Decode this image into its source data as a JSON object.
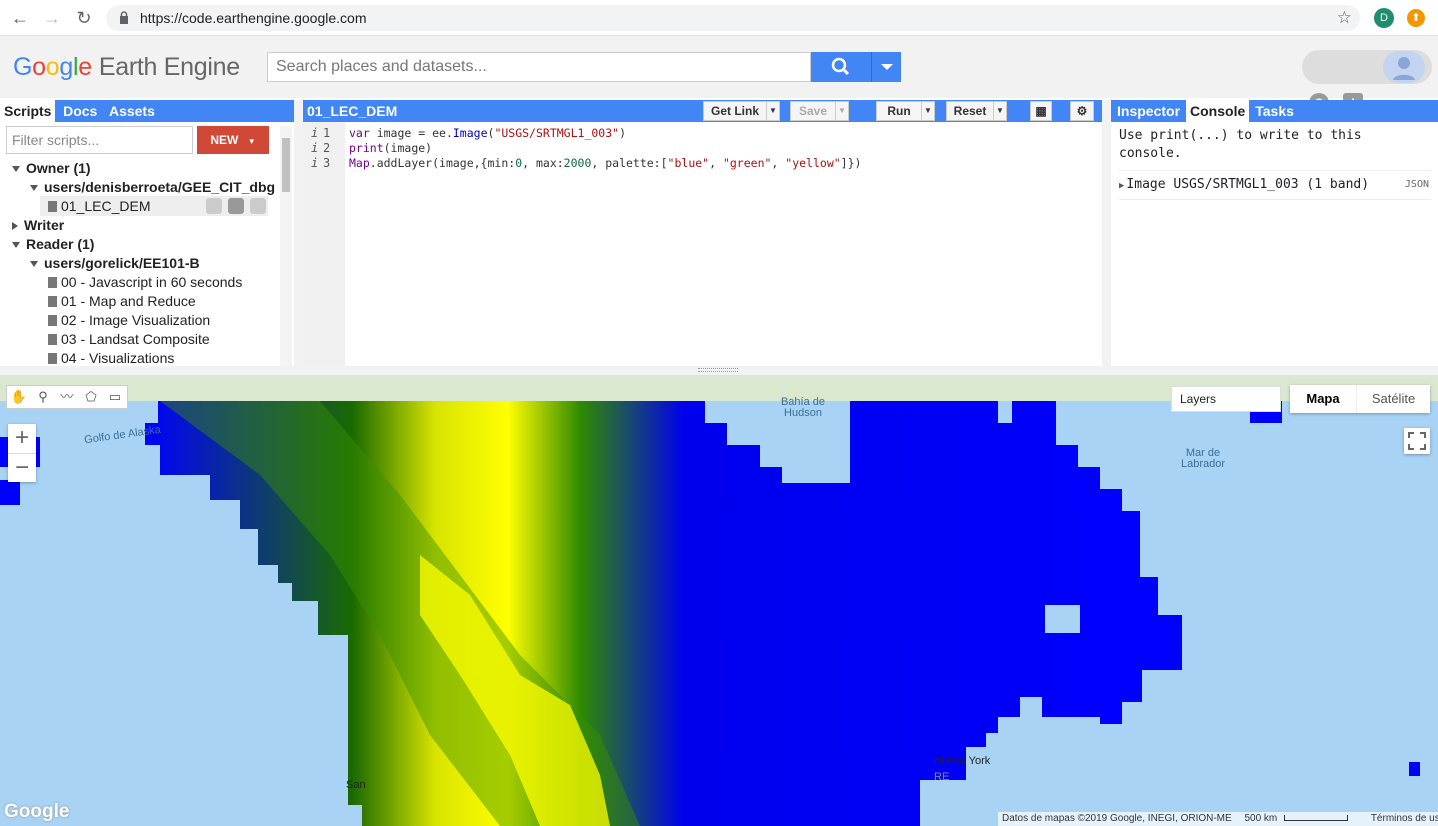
{
  "browser": {
    "url": "https://code.earthengine.google.com",
    "profile_initial": "D",
    "update_glyph": "⬆"
  },
  "header": {
    "logo_earth_engine": "Earth Engine",
    "search_placeholder": "Search places and datasets...",
    "help_glyph": "?",
    "feedback_glyph": "!"
  },
  "scripts_panel": {
    "tabs": [
      "Scripts",
      "Docs",
      "Assets"
    ],
    "active_tab": "Scripts",
    "filter_placeholder": "Filter scripts...",
    "new_button": "NEW",
    "tree": [
      {
        "label": "Owner  (1)"
      },
      {
        "label": "users/denisberroeta/GEE_CIT_dbg"
      },
      {
        "label": "01_LEC_DEM"
      },
      {
        "label": "Writer"
      },
      {
        "label": "Reader  (1)"
      },
      {
        "label": "users/gorelick/EE101-B"
      },
      {
        "label": "00 - Javascript in 60 seconds"
      },
      {
        "label": "01 - Map and Reduce"
      },
      {
        "label": "02 - Image Visualization"
      },
      {
        "label": "03 - Landsat Composite"
      },
      {
        "label": "04 - Visualizations"
      }
    ]
  },
  "editor": {
    "title": "01_LEC_DEM",
    "get_link": "Get Link",
    "save": "Save",
    "run": "Run",
    "reset": "Reset",
    "line_numbers": [
      "1",
      "2",
      "3"
    ],
    "code": {
      "l1_var": "var",
      "l1_name": " image = ee.",
      "l1_fn": "Image",
      "l1_open": "(",
      "l1_str": "\"USGS/SRTMGL1_003\"",
      "l1_close": ")",
      "l2_fn": "print",
      "l2_rest": "(image)",
      "l3_fn": "Map",
      "l3_a": ".addLayer(image,{min:",
      "l3_min": "0",
      "l3_b": ", max:",
      "l3_max": "2000",
      "l3_c": ", palette:[",
      "l3_s1": "\"blue\"",
      "l3_comma1": ", ",
      "l3_s2": "\"green\"",
      "l3_comma2": ", ",
      "l3_s3": "\"yellow\"",
      "l3_end": "]})"
    }
  },
  "right_panel": {
    "tabs": [
      "Inspector",
      "Console",
      "Tasks"
    ],
    "active_tab": "Console",
    "console_hint": "Use print(...) to write to this console.",
    "console_item": "Image USGS/SRTMGL1_003 (1 band)",
    "console_item_json": "JSON"
  },
  "map": {
    "layers_label": "Layers",
    "map_type_options": [
      "Mapa",
      "Satélite"
    ],
    "selected_map_type": "Mapa",
    "zoom_in": "+",
    "zoom_out": "−",
    "labels": {
      "hudson": "Bahía de Hudson",
      "alaska": "Golfo de Alaska",
      "labrador": "Mar de Labrador",
      "newyork": "Nueva York",
      "san": "San",
      "re": "RE"
    },
    "attribution": "Datos de mapas ©2019 Google, INEGI, ORION-ME",
    "scale": "500 km",
    "terms": "Términos de uso",
    "google_mark": "Google",
    "palette": [
      "#0000ff",
      "#008000",
      "#ffff00"
    ]
  }
}
